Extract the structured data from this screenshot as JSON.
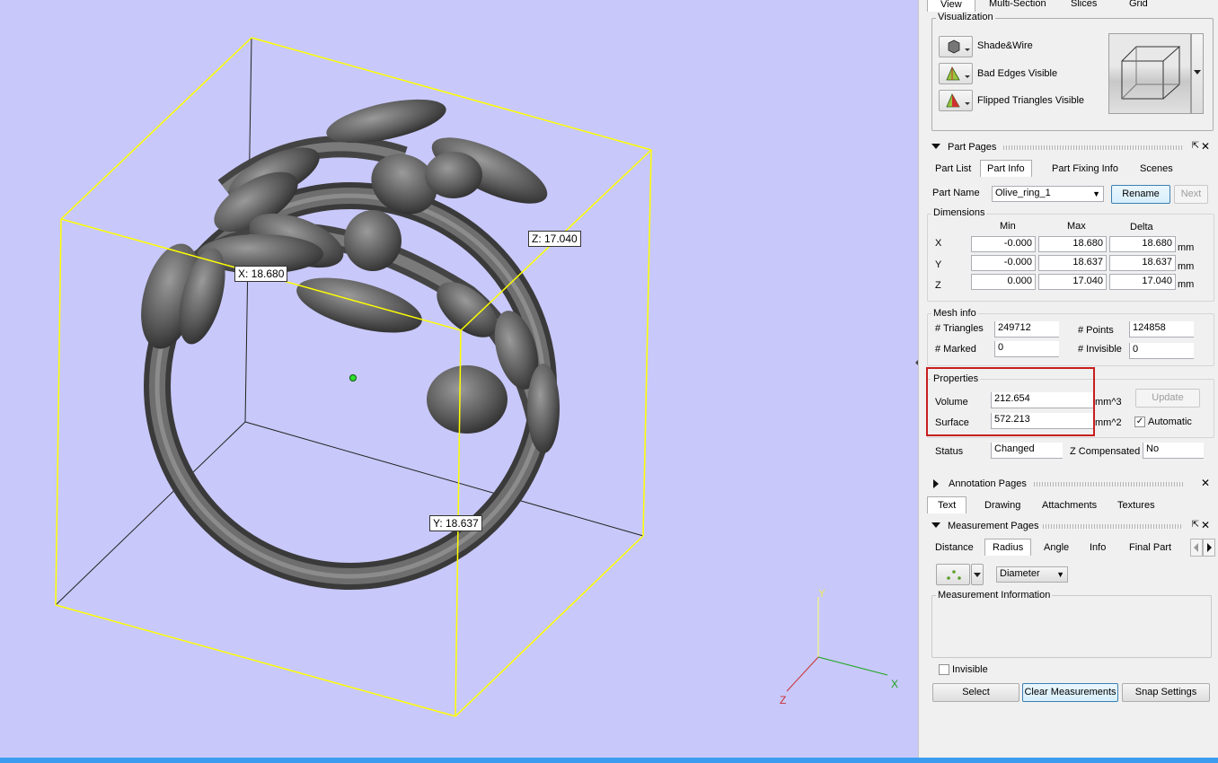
{
  "viewport": {
    "labels": {
      "x": "X: 18.680",
      "y": "Y: 18.637",
      "z": "Z: 17.040"
    },
    "axes": {
      "x": "X",
      "y": "Y",
      "z": "Z"
    },
    "colors": {
      "background": "#c8c8fa",
      "bounding_box": "#ffff00",
      "model": "#5a5a5a"
    }
  },
  "top_tabs": [
    "View",
    "Multi-Section",
    "Slices",
    "Grid"
  ],
  "visualization": {
    "title": "Visualization",
    "items": [
      "Shade&Wire",
      "Bad Edges Visible",
      "Flipped Triangles Visible"
    ]
  },
  "part_pages": {
    "title": "Part Pages",
    "tabs": [
      "Part List",
      "Part Info",
      "Part Fixing Info",
      "Scenes"
    ],
    "part_name_label": "Part Name",
    "part_name_value": "Olive_ring_1",
    "rename_label": "Rename",
    "next_label": "Next",
    "dimensions": {
      "title": "Dimensions",
      "headers": [
        "Min",
        "Max",
        "Delta"
      ],
      "rows": [
        {
          "axis": "X",
          "min": "-0.000",
          "max": "18.680",
          "delta": "18.680",
          "unit": "mm"
        },
        {
          "axis": "Y",
          "min": "-0.000",
          "max": "18.637",
          "delta": "18.637",
          "unit": "mm"
        },
        {
          "axis": "Z",
          "min": "0.000",
          "max": "17.040",
          "delta": "17.040",
          "unit": "mm"
        }
      ]
    },
    "mesh_info": {
      "title": "Mesh info",
      "triangles_label": "# Triangles",
      "triangles_value": "249712",
      "points_label": "# Points",
      "points_value": "124858",
      "marked_label": "# Marked",
      "marked_value": "0",
      "invisible_label": "# Invisible",
      "invisible_value": "0"
    },
    "properties": {
      "title": "Properties",
      "volume_label": "Volume",
      "volume_value": "212.654",
      "volume_unit": "mm^3",
      "surface_label": "Surface",
      "surface_value": "572.213",
      "surface_unit": "mm^2",
      "update_label": "Update",
      "automatic_label": "Automatic"
    },
    "status_label": "Status",
    "status_value": "Changed",
    "zcomp_label": "Z Compensated",
    "zcomp_value": "No"
  },
  "annotation_pages": {
    "title": "Annotation Pages",
    "tabs": [
      "Text",
      "Drawing",
      "Attachments",
      "Textures"
    ]
  },
  "measurement_pages": {
    "title": "Measurement Pages",
    "tabs": [
      "Distance",
      "Radius",
      "Angle",
      "Info",
      "Final Part"
    ],
    "mode_value": "Diameter",
    "info_title": "Measurement Information",
    "invisible_label": "Invisible",
    "select_label": "Select",
    "clear_label": "Clear Measurements",
    "snap_label": "Snap Settings"
  },
  "highlight_color": "#c81e1e"
}
